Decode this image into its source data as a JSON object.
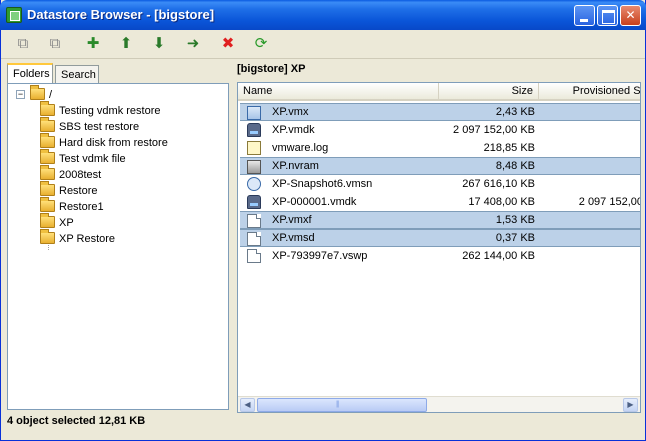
{
  "window": {
    "title": "Datastore Browser - [bigstore]"
  },
  "toolbar": {
    "tools": [
      {
        "name": "copy-icon",
        "label": "⧉",
        "color": "#8a8a8a"
      },
      {
        "name": "paste-icon",
        "label": "⧉",
        "color": "#8a8a8a"
      },
      {
        "name": "new-folder-icon",
        "label": "✚",
        "color": "#2a8a2a"
      },
      {
        "name": "upload-icon",
        "label": "⬆",
        "color": "#2a7a2a"
      },
      {
        "name": "download-icon",
        "label": "⬇",
        "color": "#2a7a2a"
      },
      {
        "name": "move-icon",
        "label": "➜",
        "color": "#2a7a2a"
      },
      {
        "name": "delete-icon",
        "label": "✖",
        "color": "#e02020"
      },
      {
        "name": "refresh-icon",
        "label": "⟳",
        "color": "#2a9a2a"
      }
    ]
  },
  "tabs": {
    "folders": "Folders",
    "search": "Search"
  },
  "tree": {
    "root": "/",
    "expander": "−",
    "folders": [
      "Testing vdmk restore",
      "SBS test restore",
      "Hard disk from restore",
      "Test vdmk file",
      "2008test",
      "Restore",
      "Restore1",
      "XP",
      "XP Restore"
    ]
  },
  "path": "[bigstore] XP",
  "columns": {
    "name": "Name",
    "size": "Size",
    "provisioned": "Provisioned Si"
  },
  "files": [
    {
      "name": "XP.vmx",
      "size": "2,43 KB",
      "provisioned": "",
      "icon": "vm",
      "selected": true
    },
    {
      "name": "XP.vmdk",
      "size": "2 097 152,00 KB",
      "provisioned": "",
      "icon": "disk",
      "selected": false
    },
    {
      "name": "vmware.log",
      "size": "218,85 KB",
      "provisioned": "",
      "icon": "log",
      "selected": false
    },
    {
      "name": "XP.nvram",
      "size": "8,48 KB",
      "provisioned": "",
      "icon": "nvram",
      "selected": true
    },
    {
      "name": "XP-Snapshot6.vmsn",
      "size": "267 616,10 KB",
      "provisioned": "",
      "icon": "snap",
      "selected": false
    },
    {
      "name": "XP-000001.vmdk",
      "size": "17 408,00 KB",
      "provisioned": "2 097 152,00",
      "icon": "disk",
      "selected": false
    },
    {
      "name": "XP.vmxf",
      "size": "1,53 KB",
      "provisioned": "",
      "icon": "doc",
      "selected": true
    },
    {
      "name": "XP.vmsd",
      "size": "0,37 KB",
      "provisioned": "",
      "icon": "doc",
      "selected": true
    },
    {
      "name": "XP-793997e7.vswp",
      "size": "262 144,00 KB",
      "provisioned": "",
      "icon": "doc",
      "selected": false
    }
  ],
  "status": "4 object selected 12,81 KB"
}
